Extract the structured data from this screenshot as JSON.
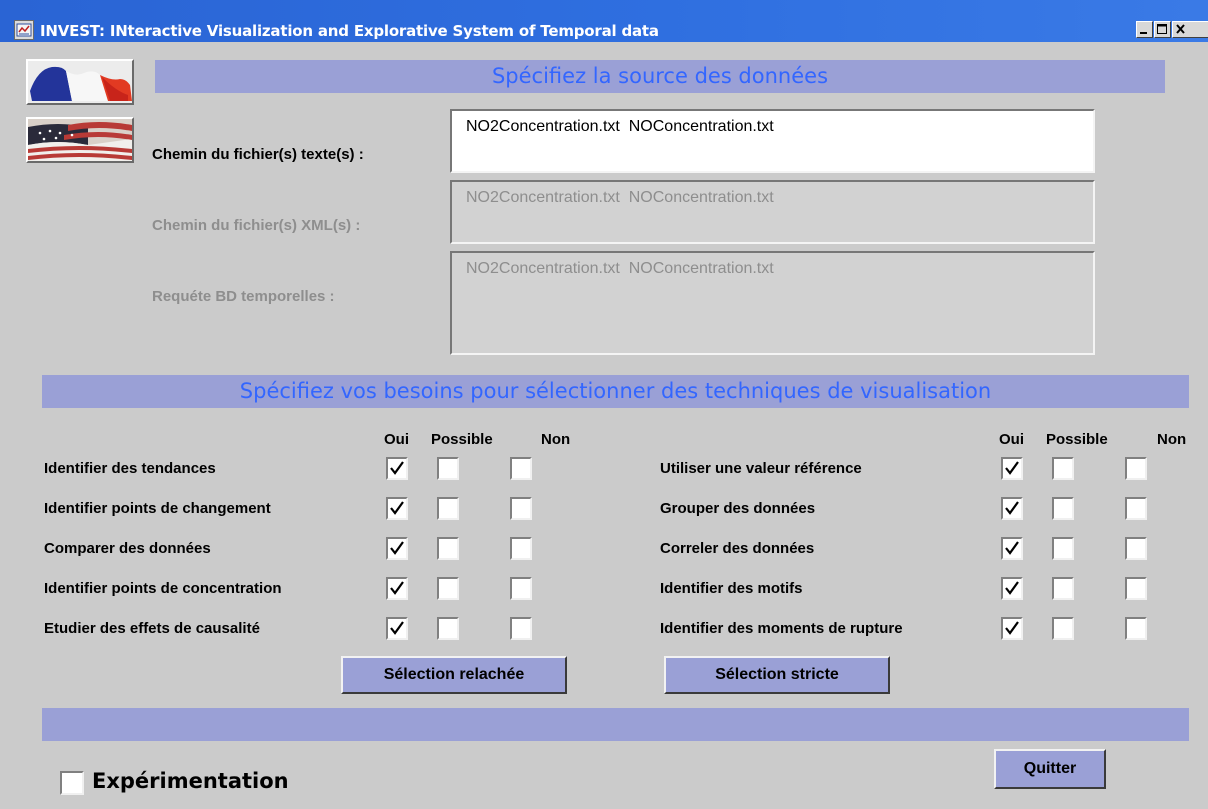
{
  "window": {
    "title": "INVEST: INteractive Visualization and Explorative System of Temporal data"
  },
  "languages": [
    {
      "name": "french-flag-icon"
    },
    {
      "name": "us-flag-icon"
    }
  ],
  "source": {
    "banner": "Spécifiez la source des données",
    "text_label": "Chemin du fichier(s) texte(s) :",
    "text_value": "NO2Concentration.txt  NOConcentration.txt",
    "xml_label": "Chemin du fichier(s) XML(s) :",
    "xml_value": "NO2Concentration.txt  NOConcentration.txt",
    "query_label": "Requéte BD temporelles :",
    "query_value": "NO2Concentration.txt  NOConcentration.txt"
  },
  "needs": {
    "banner": "Spécifiez vos besoins pour sélectionner des techniques de visualisation",
    "headers": {
      "oui": "Oui",
      "possible": "Possible",
      "non": "Non"
    },
    "left": [
      {
        "label": "Identifier des tendances",
        "checked": "oui"
      },
      {
        "label": "Identifier points de changement",
        "checked": "oui"
      },
      {
        "label": "Comparer des données",
        "checked": "oui"
      },
      {
        "label": "Identifier points de concentration",
        "checked": "oui"
      },
      {
        "label": "Etudier des effets de causalité",
        "checked": "oui"
      }
    ],
    "right": [
      {
        "label": "Utiliser une valeur référence",
        "checked": "oui"
      },
      {
        "label": "Grouper des données",
        "checked": "oui"
      },
      {
        "label": "Correler des données",
        "checked": "oui"
      },
      {
        "label": "Identifier des motifs",
        "checked": "oui"
      },
      {
        "label": "Identifier des moments de rupture",
        "checked": "oui"
      }
    ]
  },
  "buttons": {
    "relaxed": "Sélection relachée",
    "strict": "Sélection stricte",
    "quit": "Quitter"
  },
  "experiment": {
    "label": "Expérimentation",
    "checked": false
  },
  "colors": {
    "title_bar": "#2f6fe0",
    "banner": "#9aa0d6",
    "banner_text": "#3366ff",
    "background": "#cbcbcb"
  }
}
